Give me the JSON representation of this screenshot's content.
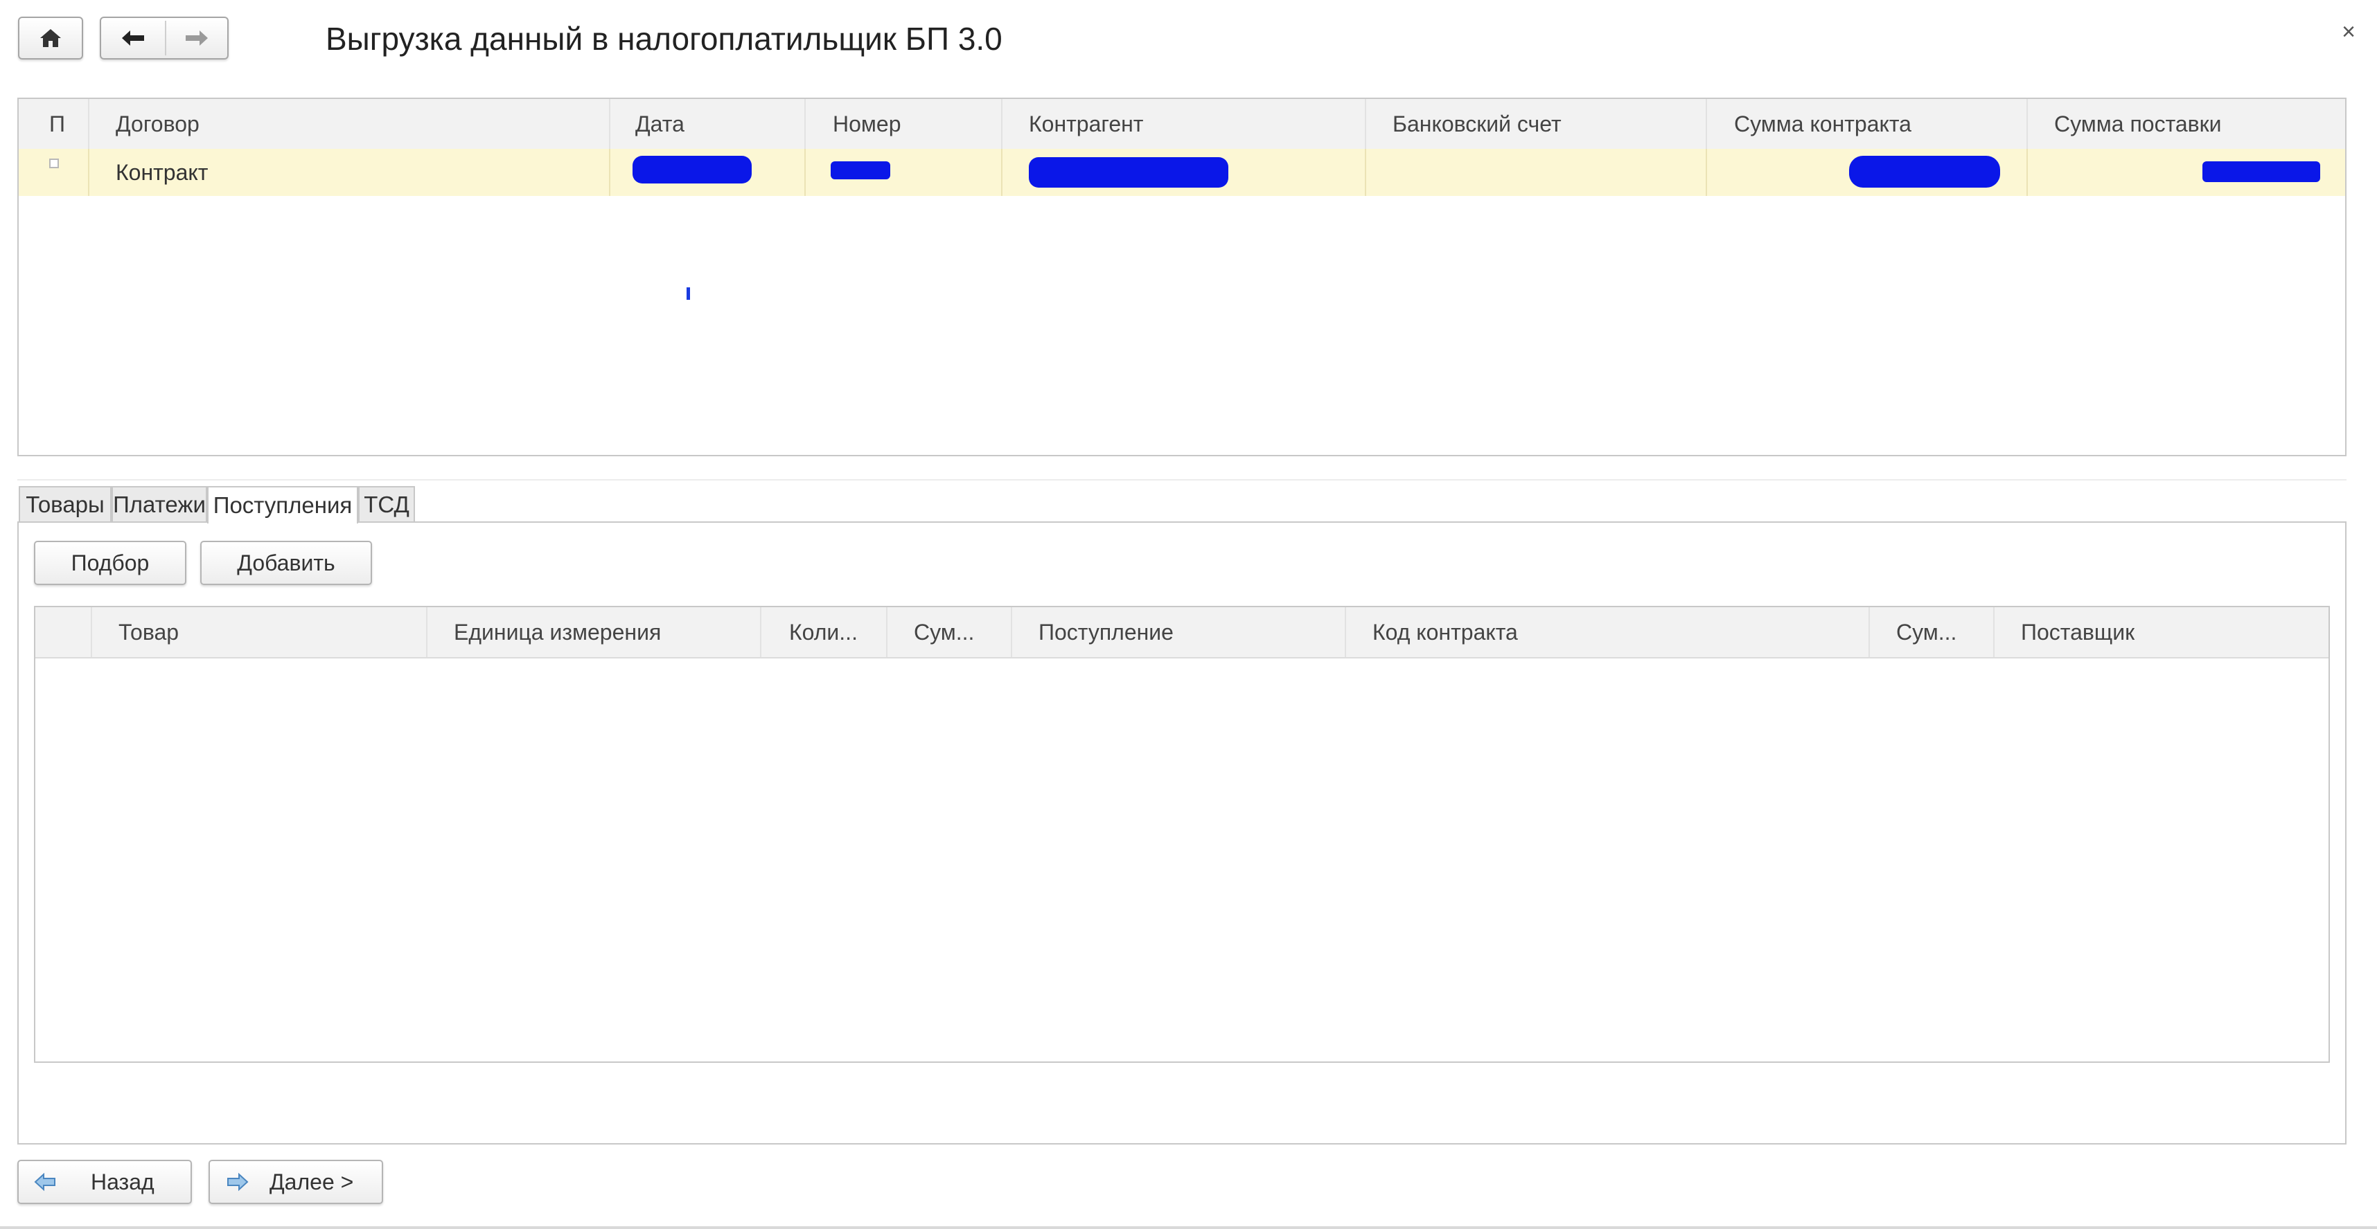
{
  "window": {
    "title": "Выгрузка данный в налогоплатильщик БП 3.0",
    "close_glyph": "×"
  },
  "toolbar": {
    "home_icon": "home-icon",
    "back_icon": "arrow-left-icon",
    "forward_icon": "arrow-right-icon"
  },
  "contracts_table": {
    "columns": [
      "П",
      "Договор",
      "Дата",
      "Номер",
      "Контрагент",
      "Банковский счет",
      "Сумма контракта",
      "Сумма поставки"
    ],
    "rows": [
      {
        "checked": false,
        "contract": "Контракт",
        "date": "",
        "number": "",
        "counterparty": "",
        "bank_account": "",
        "contract_sum": "",
        "delivery_sum": ""
      }
    ],
    "row_highlight": "#fcf7d4",
    "redaction_color": "#0a17e8"
  },
  "tabs": [
    {
      "label": "Товары",
      "active": false
    },
    {
      "label": "Платежи",
      "active": false
    },
    {
      "label": "Поступления",
      "active": true
    },
    {
      "label": "ТСД",
      "active": false
    }
  ],
  "tab_toolbar": {
    "select_label": "Подбор",
    "add_label": "Добавить"
  },
  "receipts_table": {
    "columns": [
      "",
      "Товар",
      "Единица измерения",
      "Коли...",
      "Сум...",
      "Поступление",
      "Код контракта",
      "Сум...",
      "Поставщик"
    ],
    "rows": []
  },
  "footer": {
    "back_label": "Назад",
    "next_label": "Далее >"
  }
}
